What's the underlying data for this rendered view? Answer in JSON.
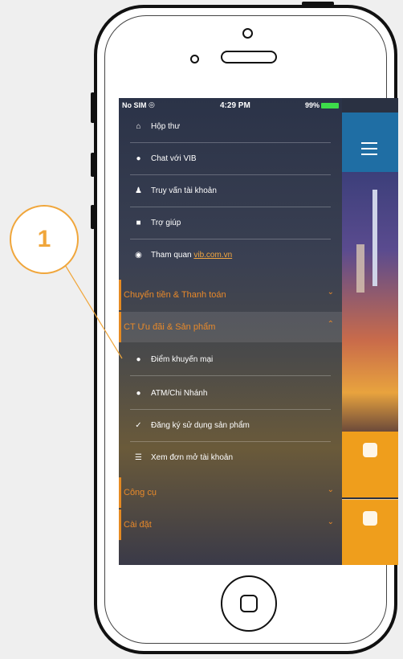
{
  "status_bar": {
    "carrier": "No SIM",
    "time": "4:29 PM",
    "battery": "99%"
  },
  "menu": {
    "items_top": [
      {
        "icon": "inbox-icon",
        "label": "Hộp thư"
      },
      {
        "icon": "chat-icon",
        "label": "Chat với VIB"
      },
      {
        "icon": "user-icon",
        "label": "Truy vấn tài khoản"
      },
      {
        "icon": "help-icon",
        "label": "Trợ giúp"
      },
      {
        "icon": "globe-icon",
        "label": "Tham quan",
        "link": "vib.com.vn"
      }
    ],
    "sections": [
      {
        "label": "Chuyển tiền & Thanh toán",
        "state": "collapsed"
      },
      {
        "label": "CT Ưu đãi & Sản phẩm",
        "state": "expanded"
      },
      {
        "label": "Công cụ",
        "state": "collapsed"
      },
      {
        "label": "Cài đặt",
        "state": "collapsed"
      }
    ],
    "sub_items": [
      {
        "icon": "dot-icon",
        "label": "Điểm khuyến mại"
      },
      {
        "icon": "dot-icon",
        "label": "ATM/Chi Nhánh"
      },
      {
        "icon": "check-icon",
        "label": "Đăng ký sử dụng sản phẩm"
      },
      {
        "icon": "list-icon",
        "label": "Xem đơn mở tài khoản"
      }
    ]
  },
  "callout": {
    "number": "1"
  },
  "colors": {
    "accent": "#e8892a",
    "menu_bg": "#2b3348",
    "header_blue": "#1f6ea4"
  }
}
